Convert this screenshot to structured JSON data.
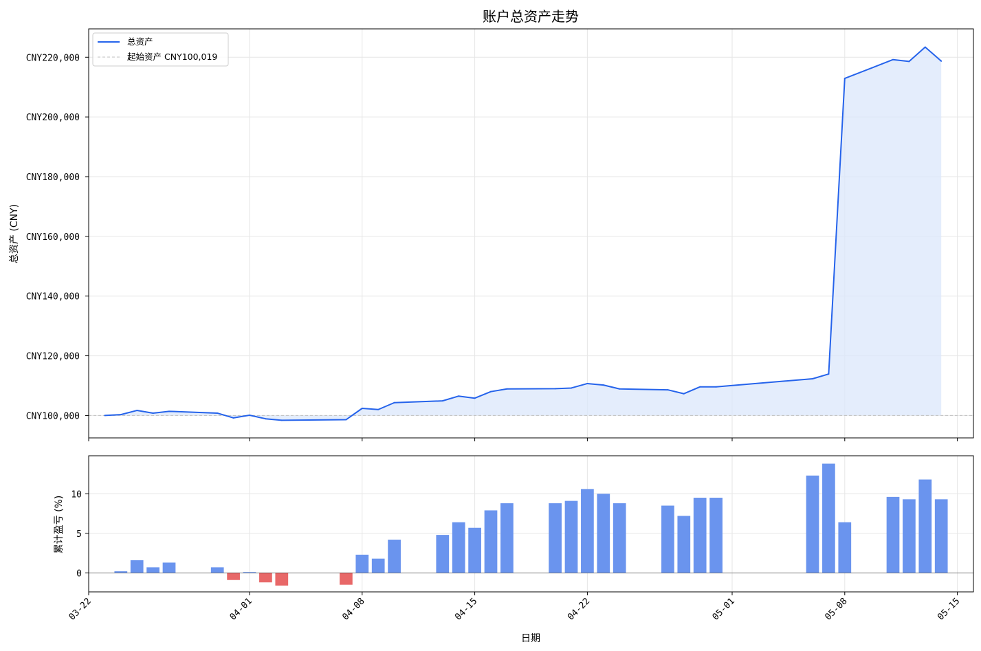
{
  "chart_data": [
    {
      "type": "line",
      "title": "账户总资产走势",
      "xlabel": "",
      "ylabel": "总资产 (CNY)",
      "y_tick_labels": [
        "CNY100,000",
        "CNY120,000",
        "CNY140,000",
        "CNY160,000",
        "CNY180,000",
        "CNY200,000",
        "CNY220,000"
      ],
      "y_ticks": [
        100000,
        120000,
        140000,
        160000,
        180000,
        200000,
        220000
      ],
      "ylim": [
        92500,
        229500
      ],
      "xlim": [
        "2025-03-22",
        "2025-05-16"
      ],
      "grid": true,
      "legend": {
        "placement": "top-left",
        "entries": [
          "总资产",
          "起始资产 CNY100,019"
        ]
      },
      "baseline": {
        "label": "起始资产 CNY100,019",
        "value": 100019,
        "color": "#c0c0c0"
      },
      "series": [
        {
          "name": "总资产",
          "color": "#2563eb",
          "fill_color": "#dbe7fb",
          "points": [
            [
              "2025-03-23",
              100000
            ],
            [
              "2025-03-24",
              100300
            ],
            [
              "2025-03-25",
              101700
            ],
            [
              "2025-03-26",
              100800
            ],
            [
              "2025-03-27",
              101400
            ],
            [
              "2025-03-30",
              100800
            ],
            [
              "2025-03-31",
              99200
            ],
            [
              "2025-04-01",
              100100
            ],
            [
              "2025-04-02",
              98900
            ],
            [
              "2025-04-03",
              98400
            ],
            [
              "2025-04-07",
              98600
            ],
            [
              "2025-04-08",
              102400
            ],
            [
              "2025-04-09",
              102000
            ],
            [
              "2025-04-10",
              104300
            ],
            [
              "2025-04-13",
              104900
            ],
            [
              "2025-04-14",
              106500
            ],
            [
              "2025-04-15",
              105800
            ],
            [
              "2025-04-16",
              108000
            ],
            [
              "2025-04-17",
              108900
            ],
            [
              "2025-04-20",
              109000
            ],
            [
              "2025-04-21",
              109200
            ],
            [
              "2025-04-22",
              110700
            ],
            [
              "2025-04-23",
              110200
            ],
            [
              "2025-04-24",
              108900
            ],
            [
              "2025-04-27",
              108600
            ],
            [
              "2025-04-28",
              107300
            ],
            [
              "2025-04-29",
              109600
            ],
            [
              "2025-04-30",
              109600
            ],
            [
              "2025-05-06",
              112300
            ],
            [
              "2025-05-07",
              113900
            ],
            [
              "2025-05-08",
              212900
            ],
            [
              "2025-05-11",
              219200
            ],
            [
              "2025-05-12",
              218600
            ],
            [
              "2025-05-13",
              223400
            ],
            [
              "2025-05-14",
              218700
            ]
          ]
        }
      ]
    },
    {
      "type": "bar",
      "title": "",
      "xlabel": "日期",
      "ylabel": "累计盈亏 (%)",
      "y_ticks": [
        0,
        5,
        10
      ],
      "y_tick_labels": [
        "0",
        "5",
        "10"
      ],
      "ylim": [
        -2.4,
        14.8
      ],
      "xlim": [
        "2025-03-22",
        "2025-05-16"
      ],
      "x_ticks": [
        "2025-03-22",
        "2025-04-01",
        "2025-04-08",
        "2025-04-15",
        "2025-04-22",
        "2025-05-01",
        "2025-05-08",
        "2025-05-15"
      ],
      "x_tick_labels": [
        "03-22",
        "04-01",
        "04-08",
        "04-15",
        "04-22",
        "05-01",
        "05-08",
        "05-15"
      ],
      "grid": true,
      "positive_color": "#6a94ee",
      "negative_color": "#e86868",
      "series": [
        {
          "points": [
            [
              "2025-03-24",
              0.2
            ],
            [
              "2025-03-25",
              1.6
            ],
            [
              "2025-03-26",
              0.7
            ],
            [
              "2025-03-27",
              1.3
            ],
            [
              "2025-03-30",
              0.7
            ],
            [
              "2025-03-31",
              -0.9
            ],
            [
              "2025-04-01",
              0.1
            ],
            [
              "2025-04-02",
              -1.2
            ],
            [
              "2025-04-03",
              -1.6
            ],
            [
              "2025-04-07",
              -1.5
            ],
            [
              "2025-04-08",
              2.3
            ],
            [
              "2025-04-09",
              1.8
            ],
            [
              "2025-04-10",
              4.2
            ],
            [
              "2025-04-13",
              4.8
            ],
            [
              "2025-04-14",
              6.4
            ],
            [
              "2025-04-15",
              5.7
            ],
            [
              "2025-04-16",
              7.9
            ],
            [
              "2025-04-17",
              8.8
            ],
            [
              "2025-04-20",
              8.8
            ],
            [
              "2025-04-21",
              9.1
            ],
            [
              "2025-04-22",
              10.6
            ],
            [
              "2025-04-23",
              10.0
            ],
            [
              "2025-04-24",
              8.8
            ],
            [
              "2025-04-27",
              8.5
            ],
            [
              "2025-04-28",
              7.2
            ],
            [
              "2025-04-29",
              9.5
            ],
            [
              "2025-04-30",
              9.5
            ],
            [
              "2025-05-06",
              12.3
            ],
            [
              "2025-05-07",
              13.8
            ],
            [
              "2025-05-08",
              6.4
            ],
            [
              "2025-05-11",
              9.6
            ],
            [
              "2025-05-12",
              9.3
            ],
            [
              "2025-05-13",
              11.8
            ],
            [
              "2025-05-14",
              9.3
            ]
          ]
        }
      ]
    }
  ]
}
